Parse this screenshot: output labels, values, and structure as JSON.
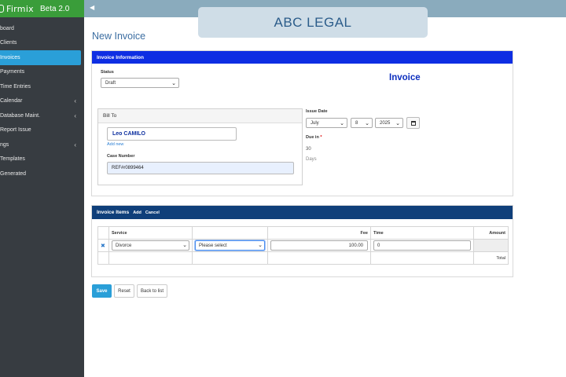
{
  "brand": {
    "name": "Firmix",
    "version": "Beta 2.0"
  },
  "sidebar": {
    "items": [
      {
        "label": "board",
        "chevron": false
      },
      {
        "label": "Clients",
        "chevron": false
      },
      {
        "label": "Invoices",
        "chevron": false,
        "active": true
      },
      {
        "label": "Payments",
        "chevron": false
      },
      {
        "label": "Time Entries",
        "chevron": false
      },
      {
        "label": "Calendar",
        "chevron": true
      },
      {
        "label": "Database Maint.",
        "chevron": true
      },
      {
        "label": "Report Issue",
        "chevron": false
      },
      {
        "label": "ngs",
        "chevron": true
      },
      {
        "label": "Templates",
        "chevron": false
      },
      {
        "label": "Generated",
        "chevron": false
      }
    ]
  },
  "banner": "ABC LEGAL",
  "page_title": "New Invoice",
  "info_panel": {
    "title": "Invoice Information",
    "status_label": "Status",
    "status_value": "Draft",
    "invoice_heading": "Invoice",
    "bill_to": {
      "title": "Bill To",
      "client": "Leo CAMILO",
      "add_new": "Add new",
      "case_label": "Case Number",
      "case_value": "REF#r0899464"
    },
    "issue_date_label": "Issue Date",
    "issue_month": "July",
    "issue_day": "8",
    "issue_year": "2025",
    "due_label": "Due in",
    "due_required": "*",
    "due_value": "30",
    "due_unit": "Days"
  },
  "items_panel": {
    "title": "Invoice Items",
    "add": "Add",
    "cancel": "Cancel",
    "headers": {
      "service": "Service",
      "fee": "Fee",
      "time": "Time",
      "amount": "Amount"
    },
    "row": {
      "service": "Divorce",
      "detail": "Please select",
      "fee": "100.00",
      "time": "0"
    },
    "total_label": "Total"
  },
  "actions": {
    "save": "Save",
    "reset": "Reset",
    "back": "Back to list"
  },
  "colors": {
    "sidebar": "#373c41",
    "brand": "#3a9d3a",
    "accent": "#2a9fd8",
    "info_header": "#0e2ee3",
    "items_header": "#0f3f7a"
  }
}
